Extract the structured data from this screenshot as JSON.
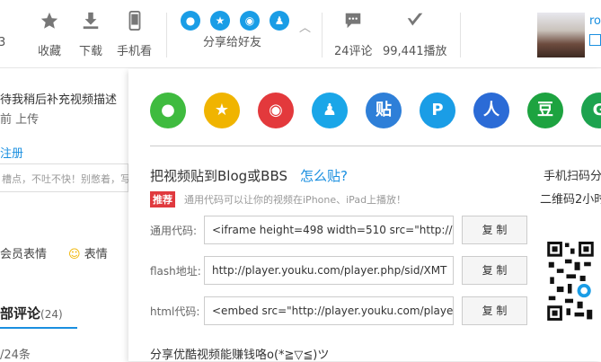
{
  "topbar": {
    "edge_num": "3",
    "collect": "收藏",
    "download": "下载",
    "mobile": "手机看",
    "share_label": "分享给好友",
    "comments": "24评论",
    "plays": "99,441播放",
    "user_partial": "ro"
  },
  "left": {
    "desc_line": "待我稍后补充视频描述",
    "uploaded": "前 上传",
    "register": "注册",
    "comment_hint": "槽点，不吐不快！别憋着，写",
    "member_emoji": "会员表情",
    "emoji": "表情",
    "all_comments": "部评论",
    "comment_count": "(24)",
    "pagination": "/24条"
  },
  "panel": {
    "share_icons": [
      "微",
      "★",
      "微",
      "Q",
      "贴",
      "P",
      "人",
      "豆",
      "G"
    ],
    "paste_title": "把视频贴到Blog或BBS",
    "how_to": "怎么贴?",
    "badge": "推荐",
    "tip": "通用代码可以让你的视频在iPhone、iPad上播放！",
    "rows": [
      {
        "label": "通用代码:",
        "value": "<iframe height=498 width=510 src=\"http://p",
        "button": "复 制"
      },
      {
        "label": "flash地址:",
        "value": "http://player.youku.com/player.php/sid/XMT",
        "button": "复 制"
      },
      {
        "label": "html代码:",
        "value": "<embed src=\"http://player.youku.com/playe",
        "button": "复 制"
      }
    ],
    "earn": "分享优酷视频能赚钱咯o(*≧▽≦)ツ",
    "mobile_scan": "手机扫码分",
    "qr_hint": "二维码2小时"
  },
  "colors": {
    "accent_link": "#1a8fe0",
    "badge_red": "#e0393e",
    "share_blue": "#1a9de6"
  }
}
